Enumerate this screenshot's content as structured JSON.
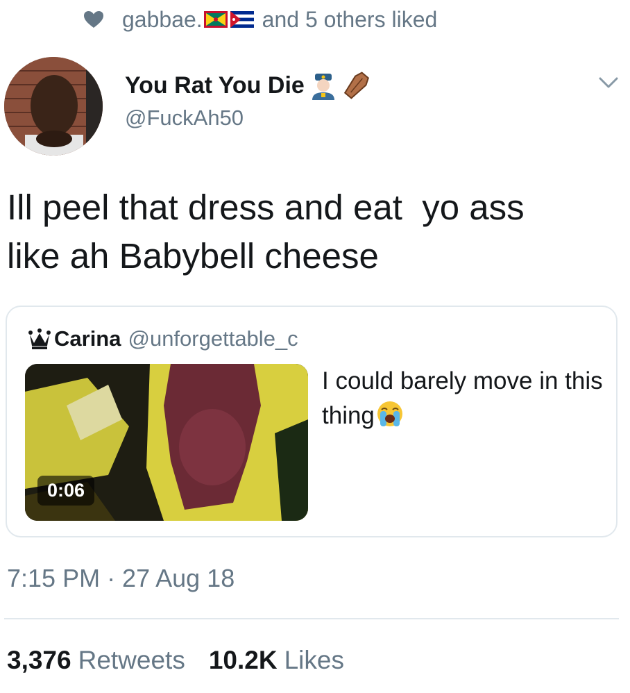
{
  "social_context": {
    "username": "gabbae.",
    "text": "and 5 others liked"
  },
  "author": {
    "name": "You Rat You Die",
    "handle": "@FuckAh50"
  },
  "tweet": {
    "text_line1": "Ill peel that dress and eat  yo ass",
    "text_line2": "like ah Babybell cheese"
  },
  "quote": {
    "name": "Carina",
    "handle": "@unforgettable_c",
    "text": "I could barely move in this thing",
    "video_duration": "0:06"
  },
  "timestamp": "7:15 PM · 27 Aug 18",
  "stats": {
    "retweets_count": "3,376",
    "retweets_label": "Retweets",
    "likes_count": "10.2K",
    "likes_label": "Likes"
  },
  "icons": {
    "heart": "heart-icon",
    "chevron": "chevron-down-icon",
    "crown": "crown-icon"
  },
  "colors": {
    "secondary_text": "#657786",
    "primary_text": "#14171a",
    "border": "#e1e8ed"
  }
}
